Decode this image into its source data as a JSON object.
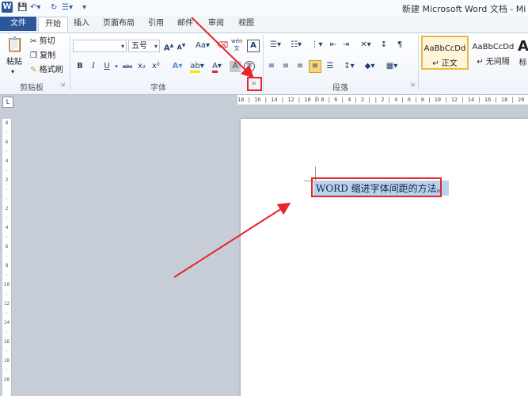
{
  "window": {
    "app_icon": "W",
    "title": "新建 Microsoft Word 文档 - Mi",
    "quick_access": [
      "save-icon",
      "undo-icon",
      "redo-icon",
      "customize-icon"
    ]
  },
  "tabs": [
    "文件",
    "开始",
    "插入",
    "页面布局",
    "引用",
    "邮件",
    "审阅",
    "视图"
  ],
  "clipboard": {
    "paste": "粘贴",
    "cut": "剪切",
    "copy": "复制",
    "format_painter": "格式刷",
    "group": "剪贴板"
  },
  "font": {
    "font_name": "",
    "font_size": "五号",
    "group": "字体",
    "grow": "A",
    "shrink": "A",
    "case": "Aa",
    "clear": "",
    "phonetic": "wén",
    "border": "A",
    "bold": "B",
    "italic": "I",
    "underline": "U",
    "strike": "abc",
    "sub": "x₂",
    "sup": "x²",
    "effects": "A",
    "highlight": "ab",
    "color": "A",
    "shade": "A",
    "enclose": "字"
  },
  "paragraph": {
    "group": "段落"
  },
  "styles": {
    "items": [
      {
        "sample": "AaBbCcDd",
        "name": "↵ 正文"
      },
      {
        "sample": "AaBbCcDd",
        "name": "↵ 无间隔"
      },
      {
        "sample": "A",
        "name": "标"
      }
    ]
  },
  "ruler": {
    "top": "18 | 16 | 14 | 12 | 10 |  8 |  6 |  4 |  2 |     |  2 |  4 |  6 |  8 | 10 | 12 | 14 | 16 | 18 | 20 | 22 |",
    "left": [
      "8",
      "·",
      "6",
      "·",
      "4",
      "·",
      "2",
      "·",
      "·",
      "2",
      "·",
      "4",
      "·",
      "6",
      "·",
      "8",
      "·",
      "10",
      "·",
      "12",
      "·",
      "14",
      "·",
      "16",
      "·",
      "18",
      "·",
      "20"
    ],
    "corner": "L"
  },
  "document": {
    "text": "WORD 缩进字体间距的方法。"
  },
  "colors": {
    "accent": "#2b579a",
    "annotation": "#e8252a",
    "selection": "#b8d3f0"
  }
}
